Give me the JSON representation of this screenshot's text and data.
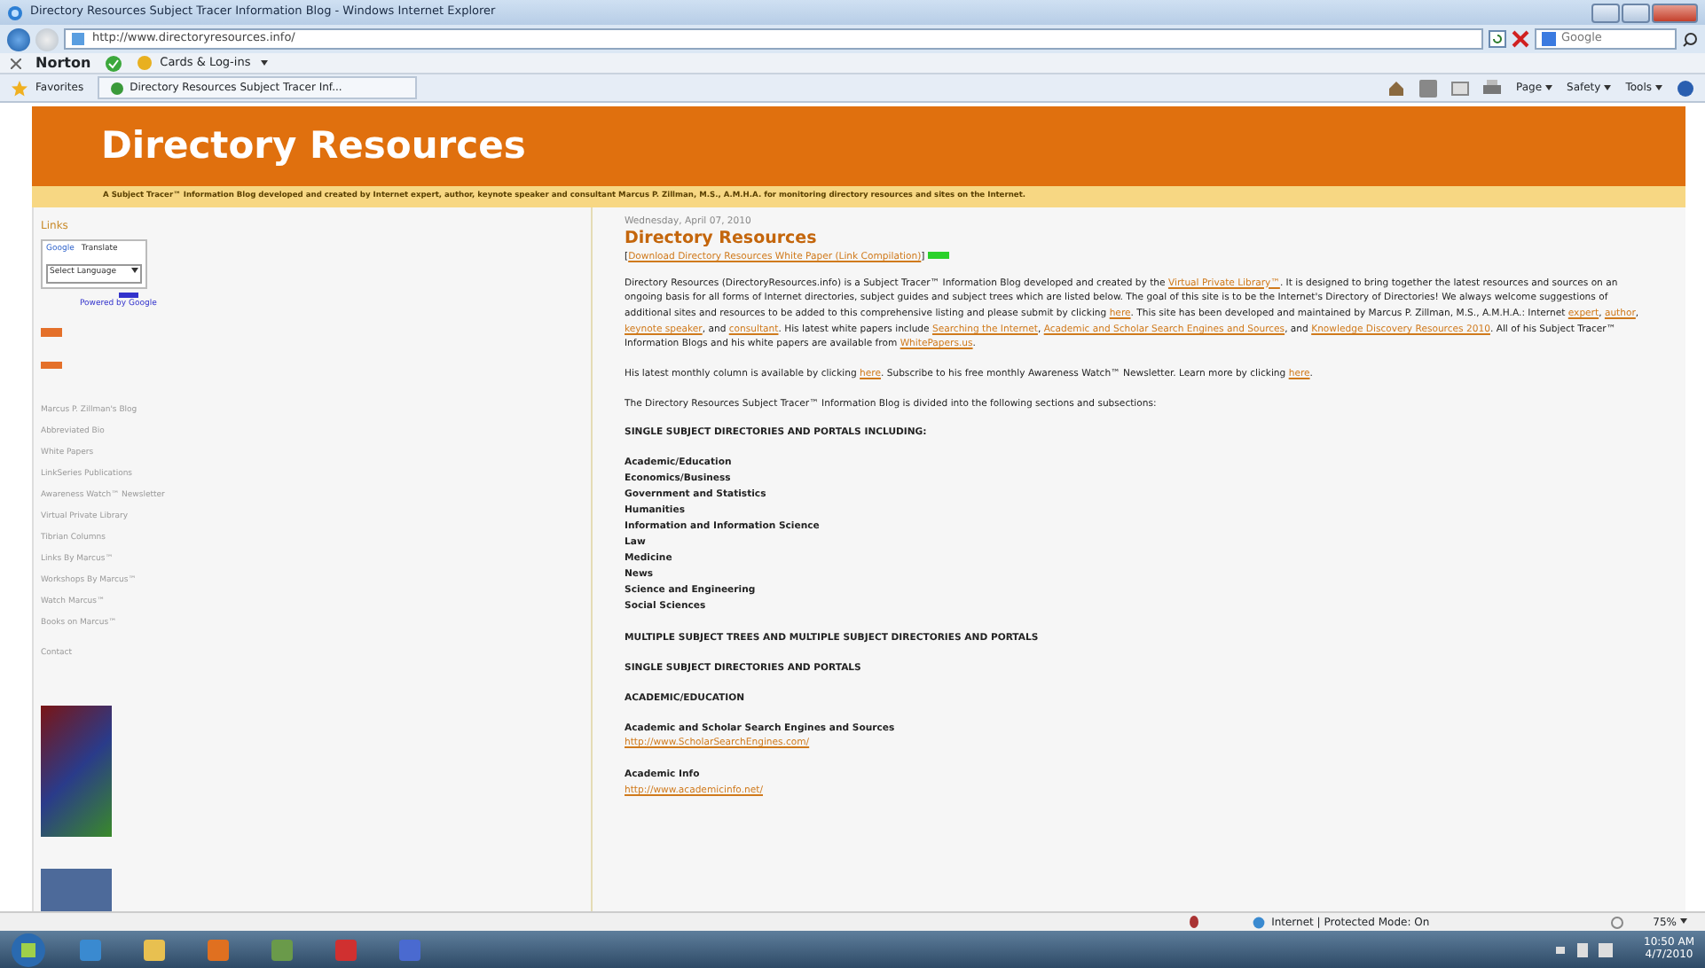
{
  "window": {
    "title": "Directory Resources Subject Tracer Information Blog - Windows Internet Explorer"
  },
  "address_bar": {
    "url": "http://www.directoryresources.info/"
  },
  "search": {
    "placeholder": "Google"
  },
  "norton_toolbar": {
    "brand": "Norton",
    "cards_menu": "Cards & Log-ins"
  },
  "favorites_bar": {
    "favorites": "Favorites",
    "tab": "Directory Resources Subject Tracer Inf...",
    "menus": [
      "Page",
      "Safety",
      "Tools"
    ]
  },
  "site": {
    "title": "Directory Resources",
    "tagline": "A Subject Tracer™ Information Blog developed and created by Internet expert, author, keynote speaker and consultant Marcus P. Zillman, M.S., A.M.H.A. for monitoring directory resources and sites on the Internet."
  },
  "sidebar": {
    "heading": "Links",
    "translate": {
      "brand": "Google",
      "label": "Translate",
      "select": "Select Language",
      "powered": "Powered by Google"
    },
    "links": [
      "Marcus P. Zillman's Blog",
      "Abbreviated Bio",
      "White Papers",
      "LinkSeries Publications",
      "Awareness Watch™ Newsletter",
      "Virtual Private Library",
      "Tibrian Columns",
      "Links By Marcus™",
      "Workshops By Marcus™",
      "Watch Marcus™",
      "Books on Marcus™"
    ],
    "contact": "Contact"
  },
  "post": {
    "date": "Wednesday, April 07, 2010",
    "title": "Directory Resources",
    "download": [
      {
        "text": "["
      },
      {
        "text": "Download Directory Resources White Paper (Link Compilation)",
        "link": true
      },
      {
        "text": "]"
      }
    ],
    "blocks": [
      {
        "kind": "paragraph",
        "segments": [
          {
            "text": "Directory Resources (DirectoryResources.info) is a Subject Tracer™ Information Blog developed and created by the "
          },
          {
            "text": "Virtual Private Library™",
            "link": true
          },
          {
            "text": ". It is designed to bring together the latest resources and sources on an ongoing basis for all forms of Internet directories, subject guides and subject trees which are listed below. The goal of this site is to be the Internet's Directory of Directories! We always welcome suggestions of additional sites and resources to be added to this comprehensive listing and please submit by clicking "
          },
          {
            "text": "here",
            "link": true
          },
          {
            "text": ". This site has been developed and maintained by Marcus P. Zillman, M.S., A.M.H.A.: Internet "
          },
          {
            "text": "expert",
            "link": true
          },
          {
            "text": ", "
          },
          {
            "text": "author",
            "link": true
          },
          {
            "text": ", "
          },
          {
            "text": "keynote speaker",
            "link": true
          },
          {
            "text": ", and "
          },
          {
            "text": "consultant",
            "link": true
          },
          {
            "text": ". His latest white papers include "
          },
          {
            "text": "Searching the Internet",
            "link": true
          },
          {
            "text": ", "
          },
          {
            "text": "Academic and Scholar Search Engines and Sources",
            "link": true
          },
          {
            "text": ", and "
          },
          {
            "text": "Knowledge Discovery Resources 2010",
            "link": true
          },
          {
            "text": ". All of his Subject Tracer™ Information Blogs and his white papers are available from "
          },
          {
            "text": "WhitePapers.us",
            "link": true
          },
          {
            "text": "."
          }
        ]
      },
      {
        "kind": "paragraph",
        "segments": [
          {
            "text": "His latest monthly column is available by clicking "
          },
          {
            "text": "here",
            "link": true
          },
          {
            "text": ". Subscribe to his free monthly Awareness Watch™ Newsletter. Learn more by clicking "
          },
          {
            "text": "here",
            "link": true
          },
          {
            "text": "."
          }
        ]
      },
      {
        "kind": "paragraph",
        "segments": [
          {
            "text": "The Directory Resources Subject Tracer™ Information Blog is divided into the following sections and subsections:"
          }
        ]
      },
      {
        "kind": "heading",
        "text": "SINGLE SUBJECT DIRECTORIES AND PORTALS INCLUDING:"
      },
      {
        "kind": "list",
        "items": [
          "Academic/Education",
          "Economics/Business",
          "Government and Statistics",
          "Humanities",
          "Information and Information Science",
          "Law",
          "Medicine",
          "News",
          "Science and Engineering",
          "Social Sciences"
        ]
      },
      {
        "kind": "heading",
        "text": "MULTIPLE SUBJECT TREES AND MULTIPLE SUBJECT DIRECTORIES AND PORTALS"
      },
      {
        "kind": "heading",
        "text": "SINGLE SUBJECT DIRECTORIES AND PORTALS"
      },
      {
        "kind": "heading",
        "text": "ACADEMIC/EDUCATION"
      },
      {
        "kind": "entry",
        "name": "Academic and Scholar Search Engines and Sources",
        "url": "http://www.ScholarSearchEngines.com/"
      },
      {
        "kind": "entry",
        "name": "Academic Info",
        "url": "http://www.academicinfo.net/"
      }
    ]
  },
  "status_bar": {
    "zone": "Internet | Protected Mode: On",
    "zoom": "75%"
  },
  "taskbar": {
    "time": "10:50 AM",
    "date": "4/7/2010"
  }
}
